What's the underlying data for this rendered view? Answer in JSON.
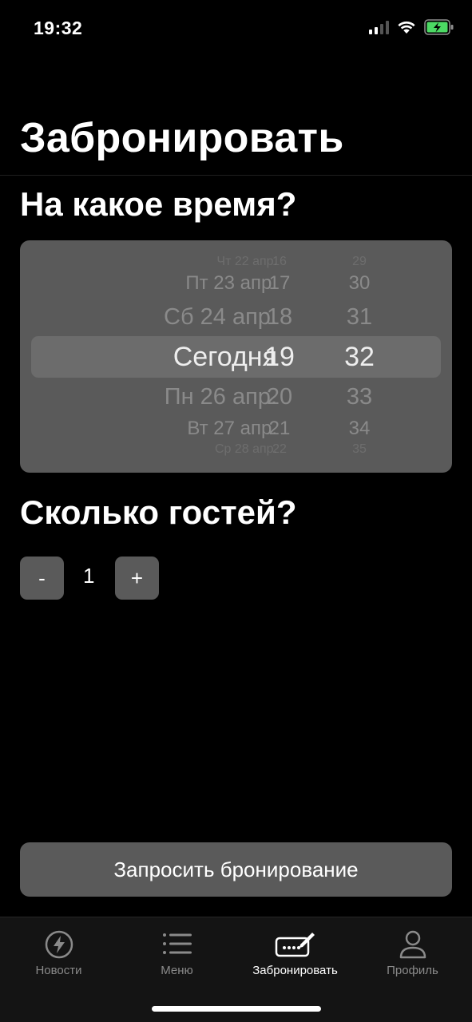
{
  "status_bar": {
    "time": "19:32"
  },
  "header": {
    "title": "Забронировать"
  },
  "time_section": {
    "title": "На какое время?",
    "picker": {
      "dates": [
        "Чт 22 апр.",
        "Пт 23 апр.",
        "Сб 24 апр.",
        "Сегодня",
        "Пн 26 апр.",
        "Вт 27 апр.",
        "Ср 28 апр."
      ],
      "hours": [
        "16",
        "17",
        "18",
        "19",
        "20",
        "21",
        "22"
      ],
      "minutes": [
        "29",
        "30",
        "31",
        "32",
        "33",
        "34",
        "35"
      ],
      "selected": {
        "date": "Сегодня",
        "hour": "19",
        "minute": "32"
      }
    }
  },
  "guests_section": {
    "title": "Сколько гостей?",
    "minus_label": "-",
    "plus_label": "+",
    "count": "1"
  },
  "request_button": {
    "label": "Запросить бронирование"
  },
  "tab_bar": {
    "tabs": [
      {
        "label": "Новости",
        "icon": "lightning-icon",
        "active": false
      },
      {
        "label": "Меню",
        "icon": "list-icon",
        "active": false
      },
      {
        "label": "Забронировать",
        "icon": "booking-icon",
        "active": true
      },
      {
        "label": "Профиль",
        "icon": "person-icon",
        "active": false
      }
    ]
  },
  "colors": {
    "background": "#000000",
    "surface": "#5a5a5a",
    "muted_text": "#8a8a8a"
  }
}
